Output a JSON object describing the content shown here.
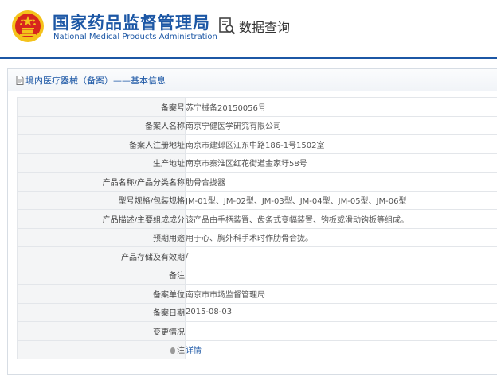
{
  "header": {
    "title_cn": "国家药品监督管理局",
    "title_en": "National Medical Products Administration",
    "query_label": "数据查询",
    "logo_icon": "national-emblem-icon",
    "query_icon": "search-document-icon"
  },
  "panel": {
    "title": "境内医疗器械（备案）——基本信息",
    "title_icon": "document-icon"
  },
  "rows": [
    {
      "label": "备案号",
      "value": "苏宁械备20150056号"
    },
    {
      "label": "备案人名称",
      "value": "南京宁健医学研究有限公司"
    },
    {
      "label": "备案人注册地址",
      "value": "南京市建邺区江东中路186-1号1502室"
    },
    {
      "label": "生产地址",
      "value": "南京市秦淮区红花街道金家圩58号"
    },
    {
      "label": "产品名称/产品分类名称",
      "value": "肋骨合拢器"
    },
    {
      "label": "型号规格/包装规格",
      "value": "JM-01型、JM-02型、JM-03型、JM-04型、JM-05型、JM-06型"
    },
    {
      "label": "产品描述/主要组成成分",
      "value": "该产品由手柄装置、齿条式变幅装置、钩板或滑动钩板等组成。"
    },
    {
      "label": "预期用途",
      "value": "用于心、胸外科手术时作肋骨合拢。"
    },
    {
      "label": "产品存储及有效期",
      "value": "/"
    },
    {
      "label": "备注",
      "value": ""
    },
    {
      "label": "备案单位",
      "value": "南京市市场监督管理局"
    },
    {
      "label": "备案日期",
      "value": "2015-08-03"
    },
    {
      "label": "变更情况",
      "value": ""
    },
    {
      "label": "注",
      "value": "详情"
    }
  ],
  "colors": {
    "brand": "#1c57a5",
    "emblem_red": "#d7261e",
    "emblem_gold": "#f4c21b"
  }
}
